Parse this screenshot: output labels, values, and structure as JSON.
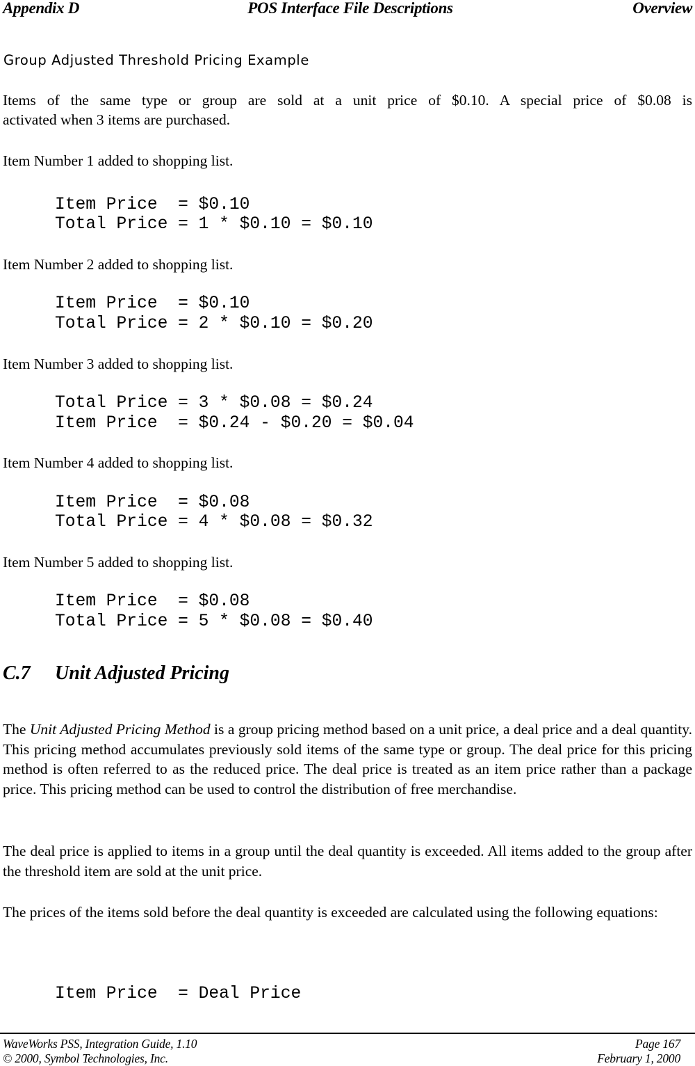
{
  "header": {
    "left": "Appendix D",
    "center": "POS Interface File Descriptions",
    "right": "Overview"
  },
  "example": {
    "heading": "Group Adjusted Threshold Pricing Example",
    "intro_line1": "Items of the same type or group are sold at a unit price of $0.10.  A special price of $0.08 is",
    "intro_line2": "activated when 3 items are purchased.",
    "steps": [
      {
        "label": "Item Number 1 added to shopping list.",
        "code": [
          "Item Price  = $0.10",
          "Total Price = 1 * $0.10 = $0.10"
        ]
      },
      {
        "label": "Item Number 2 added to shopping list.",
        "code": [
          "Item Price  = $0.10",
          "Total Price = 2 * $0.10 = $0.20"
        ]
      },
      {
        "label": "Item Number 3 added to shopping list.",
        "code": [
          "Total Price = 3 * $0.08 = $0.24",
          "Item Price  = $0.24 - $0.20 = $0.04"
        ]
      },
      {
        "label": "Item Number 4 added to shopping list.",
        "code": [
          "Item Price  = $0.08",
          "Total Price = 4 * $0.08 = $0.32"
        ]
      },
      {
        "label": "Item Number 5 added to shopping list.",
        "code": [
          "Item Price  = $0.08",
          "Total Price = 5 * $0.08 = $0.40"
        ]
      }
    ]
  },
  "section": {
    "number": "C.7",
    "title": "Unit Adjusted Pricing",
    "para1": {
      "prefix": "The ",
      "italic": "Unit Adjusted Pricing Method",
      "rest": " is a group pricing method based on a unit price, a deal price and a deal quantity.  This pricing method accumulates previously sold items of the same type or group. The deal price for this pricing method is often referred to as the reduced price.  The deal price is treated as an item price rather than a package price.  This pricing method can be used to control the distribution of free merchandise."
    },
    "para2": "The deal price is applied to items in a group until the deal quantity is exceeded.  All items added to the group after the threshold item are sold at the unit price.",
    "para3": "The prices of the items sold before the deal quantity is exceeded are calculated using the following equations:",
    "equation": "Item Price  = Deal Price"
  },
  "footer": {
    "left_line1": "WaveWorks PSS, Integration Guide, 1.10",
    "left_line2": "© 2000, Symbol Technologies, Inc.",
    "right_line1": "Page 167",
    "right_line2": "February 1, 2000"
  }
}
